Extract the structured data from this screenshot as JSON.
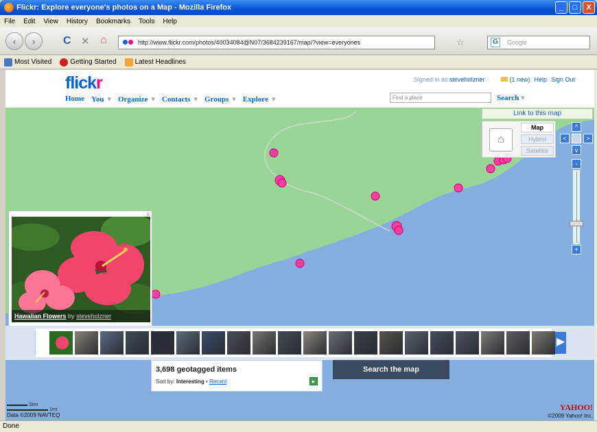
{
  "window": {
    "title": "Flickr: Explore everyone's photos on a Map - Mozilla Firefox",
    "controls": [
      "_",
      "□",
      "X"
    ]
  },
  "menu": [
    "File",
    "Edit",
    "View",
    "History",
    "Bookmarks",
    "Tools",
    "Help"
  ],
  "nav": {
    "back": "‹",
    "forward": "›",
    "reload": "C",
    "stop": "✕",
    "home": "⌂",
    "url": "http://www.flickr.com/photos/40034084@N07/3684239167/map/?view=everyones",
    "star": "☆",
    "search_engine": "G",
    "search_placeholder": "Google",
    "search_icon": "🔍"
  },
  "bookmarks": [
    {
      "label": "Most Visited",
      "color": "#4a78c8"
    },
    {
      "label": "Getting Started",
      "color": "#cc2222"
    },
    {
      "label": "Latest Headlines",
      "color": "#f2a43a"
    }
  ],
  "flickr": {
    "logo_a": "flick",
    "logo_b": "r",
    "signed_in_prefix": "Signed in as",
    "username": "stevehoIzner",
    "inbox": "(1 new)",
    "help": "Help",
    "signout": "Sign Out",
    "nav": [
      "Home",
      "You",
      "Organize",
      "Contacts",
      "Groups",
      "Explore"
    ],
    "find_placeholder": "Find a place",
    "search_label": "Search"
  },
  "map": {
    "link_label": "Link to this map",
    "types": [
      "Map",
      "Hybrid",
      "Satellite"
    ],
    "selected_type": "Map",
    "land_color": "#98d597",
    "water_color": "#84aedf",
    "marker_color": "#ff3da0",
    "pan": {
      "up": "^",
      "left": "<",
      "right": ">",
      "down": "v"
    },
    "zoom": {
      "in": "+",
      "out": "-"
    },
    "zoom_level_fraction": 0.72
  },
  "popup": {
    "title": "Hawaiian Flowers",
    "by": "by",
    "owner": "steveholzner",
    "close": "x"
  },
  "filmstrip": {
    "prev": "◀",
    "next": "▶",
    "thumb_colors": [
      "#2a7a2a",
      "#8a8276",
      "#5b6c86",
      "#3d4a55",
      "#2b2e3a",
      "#5a6d7c",
      "#3b4d68",
      "#4a4f55",
      "#7a7670",
      "#454a52",
      "#8b857c",
      "#6a6f76",
      "#3a3f46",
      "#58534c",
      "#5b6473",
      "#464e5d",
      "#4d5360",
      "#7a7c78",
      "#5b5d62",
      "#7f7b73"
    ]
  },
  "results": {
    "count": "3,698 geotagged items",
    "sort_prefix": "Sort by:",
    "sort_selected": "Interesting",
    "sort_sep": " • ",
    "sort_other": "Recent",
    "go": "▸",
    "search_map": "Search the map"
  },
  "scale": {
    "km": "1km",
    "mi": "1mi"
  },
  "attribution": {
    "data": "Data ©2009 NAVTEQ",
    "yahoo_logo": "YAHOO!",
    "yahoo_copy": "©2009 Yahoo! Inc."
  },
  "status": "Done"
}
